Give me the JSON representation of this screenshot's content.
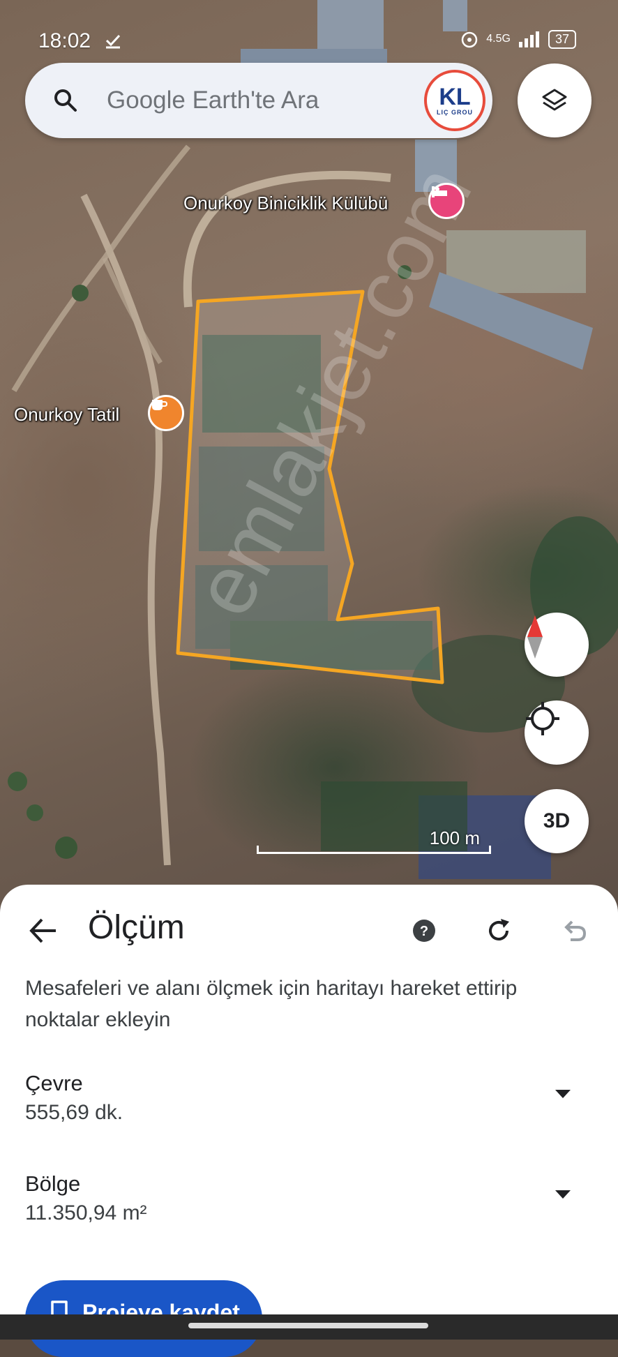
{
  "status_bar": {
    "time": "18:02",
    "network": "4.5G",
    "battery": "37"
  },
  "search": {
    "placeholder": "Google Earth'te Ara",
    "logo_letters": "KL",
    "logo_text": "LIÇ GROU"
  },
  "map": {
    "places": [
      {
        "name": "Onurkoy Biniciklik Külübü",
        "icon": "hotel-icon",
        "color": "#e8447a"
      },
      {
        "name": "Onurkoy Tatil",
        "icon": "cafe-icon",
        "color": "#f0852d"
      }
    ],
    "polygon_color": "#f5a623",
    "scale_label": "100 m",
    "watermark": "emlakjet.com",
    "button_3d": "3D"
  },
  "measure": {
    "title": "Ölçüm",
    "instructions": "Mesafeleri ve alanı ölçmek için haritayı hareket ettirip noktalar ekleyin",
    "perimeter": {
      "label": "Çevre",
      "value": "555,69 dk."
    },
    "area": {
      "label": "Bölge",
      "value": "11.350,94 m²"
    },
    "save_label": "Projeye kaydet",
    "accent": "#1a56c7"
  }
}
